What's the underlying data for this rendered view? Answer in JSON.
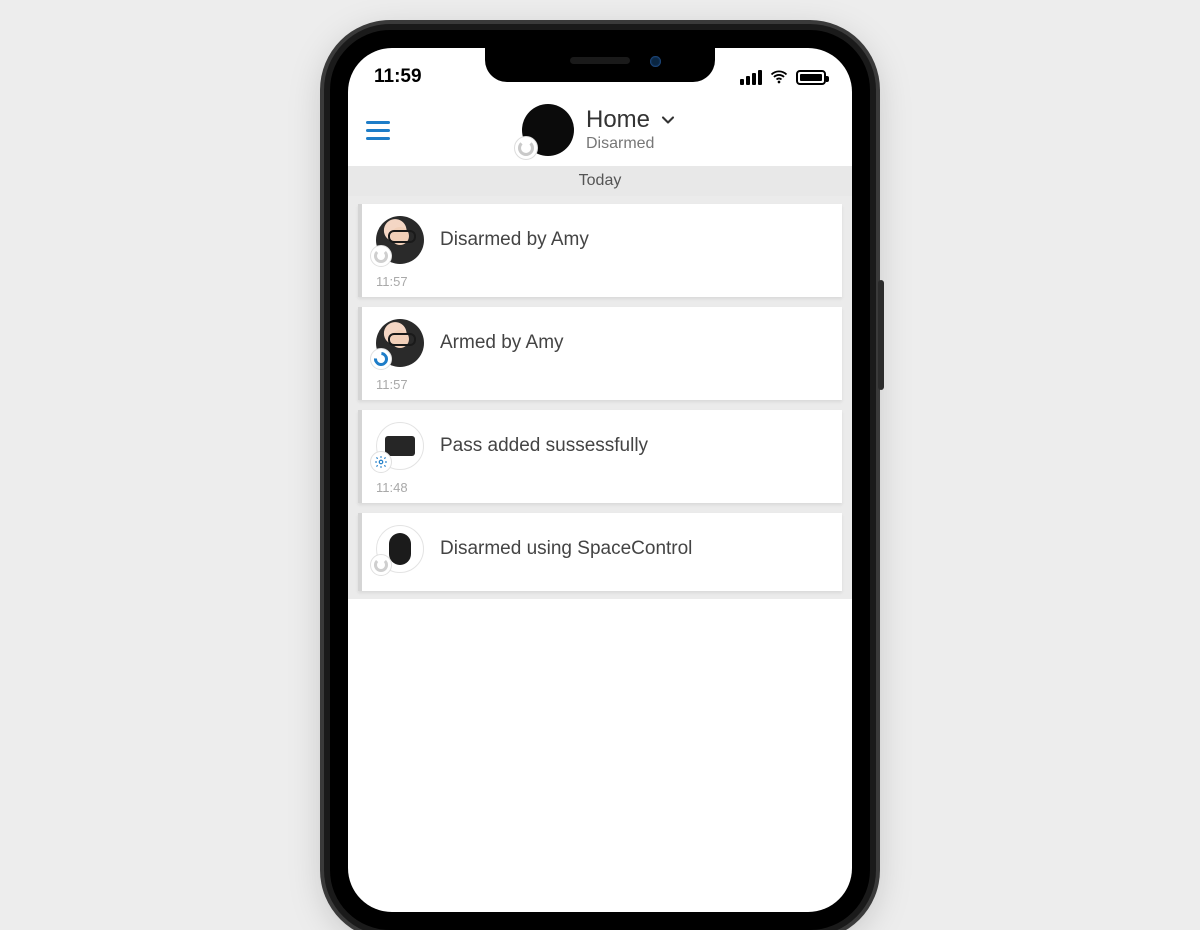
{
  "status_bar": {
    "time": "11:59"
  },
  "header": {
    "title": "Home",
    "subtitle": "Disarmed"
  },
  "day_header": "Today",
  "events": [
    {
      "text": "Disarmed by Amy",
      "time": "11:57",
      "avatar": "person",
      "badge": "grey-spin"
    },
    {
      "text": "Armed by Amy",
      "time": "11:57",
      "avatar": "person",
      "badge": "blue-ring"
    },
    {
      "text": "Pass added sussessfully",
      "time": "11:48",
      "avatar": "device-card",
      "badge": "gear"
    },
    {
      "text": "Disarmed using SpaceControl",
      "time": "",
      "avatar": "keyfob",
      "badge": "grey-spin"
    }
  ]
}
